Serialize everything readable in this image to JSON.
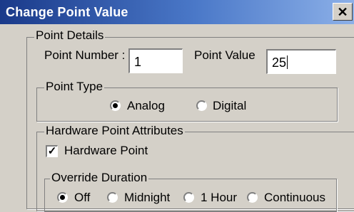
{
  "window": {
    "title": "Change Point Value",
    "close_glyph": "✕"
  },
  "point_details": {
    "legend": "Point Details",
    "point_number_label": "Point Number :",
    "point_number_value": "1",
    "point_value_label": "Point Value",
    "point_value_value": "25"
  },
  "point_type": {
    "legend": "Point Type",
    "options": [
      {
        "label": "Analog",
        "selected": true
      },
      {
        "label": "Digital",
        "selected": false
      }
    ]
  },
  "hardware": {
    "legend": "Hardware Point Attributes",
    "checkbox_label": "Hardware Point",
    "checked": true,
    "check_glyph": "✓"
  },
  "override": {
    "legend": "Override Duration",
    "options": [
      {
        "label": "Off",
        "selected": true
      },
      {
        "label": "Midnight",
        "selected": false
      },
      {
        "label": "1 Hour",
        "selected": false
      },
      {
        "label": "Continuous",
        "selected": false
      }
    ]
  }
}
